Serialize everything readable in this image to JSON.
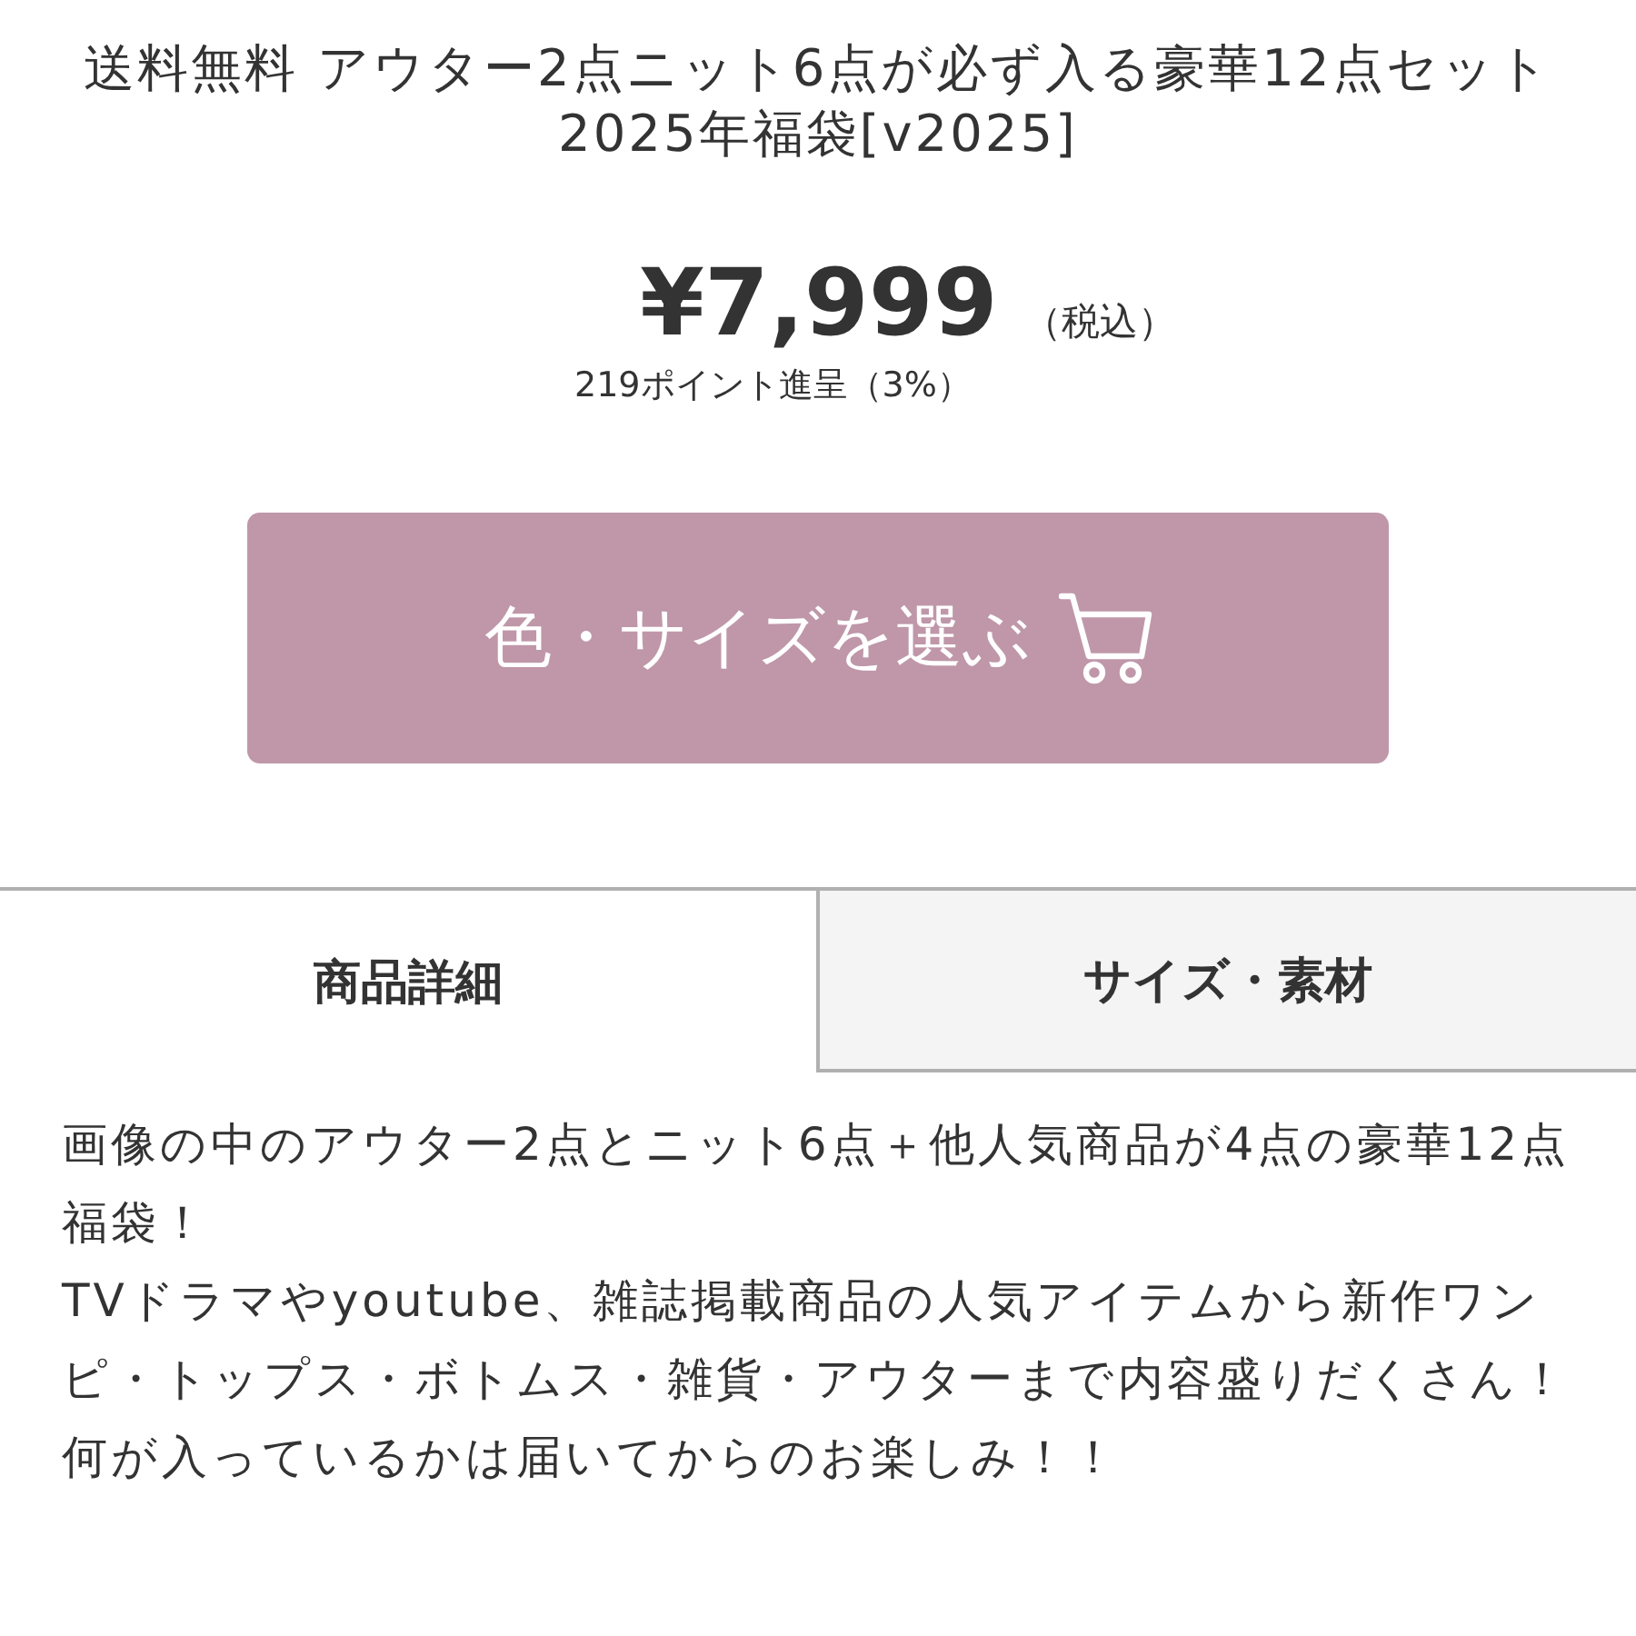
{
  "title": {
    "text": "送料無料 アウター2点ニット6点が必ず入る豪華12点セット 2025年福袋[v2025]"
  },
  "price": {
    "amount": "¥7,999",
    "tax_note": "（税込）",
    "points": "219ポイント進呈（3%）"
  },
  "select_button": {
    "label": "色・サイズを選ぶ"
  },
  "tabs": [
    {
      "label": "商品詳細",
      "selected": true
    },
    {
      "label": "サイズ・素材",
      "selected": false
    }
  ],
  "description": {
    "paragraphs": [
      "画像の中のアウター2点とニット6点＋他人気商品が4点の豪華12点福袋！",
      "TVドラマやyoutube、雑誌掲載商品の人気アイテムから新作ワンピ・トップス・ボトムス・雑貨・アウターまで内容盛りだくさん！",
      "何が入っているかは届いてからのお楽しみ！！"
    ]
  }
}
